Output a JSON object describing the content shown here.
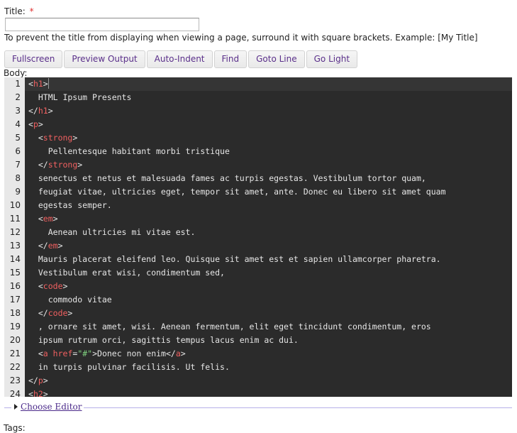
{
  "title_field": {
    "label": "Title:",
    "required_marker": "*",
    "value": "",
    "placeholder": ""
  },
  "hint": "To prevent the title from displaying when viewing a page, surround it with square brackets. Example: [My Title]",
  "toolbar": {
    "buttons": [
      {
        "label": "Fullscreen"
      },
      {
        "label": "Preview Output"
      },
      {
        "label": "Auto-Indent"
      },
      {
        "label": "Find"
      },
      {
        "label": "Goto Line"
      },
      {
        "label": "Go Light"
      }
    ]
  },
  "body_label": "Body:",
  "editor": {
    "active_line": 1,
    "lines": [
      {
        "n": "1",
        "segs": [
          [
            "b",
            "<"
          ],
          [
            "t",
            "h1"
          ],
          [
            "b",
            ">"
          ]
        ]
      },
      {
        "n": "2",
        "segs": [
          [
            "x",
            "  HTML Ipsum Presents"
          ]
        ]
      },
      {
        "n": "3",
        "segs": [
          [
            "b",
            "</"
          ],
          [
            "t",
            "h1"
          ],
          [
            "b",
            ">"
          ]
        ]
      },
      {
        "n": "4",
        "segs": [
          [
            "b",
            "<"
          ],
          [
            "t",
            "p"
          ],
          [
            "b",
            ">"
          ]
        ]
      },
      {
        "n": "5",
        "segs": [
          [
            "x",
            "  "
          ],
          [
            "b",
            "<"
          ],
          [
            "t",
            "strong"
          ],
          [
            "b",
            ">"
          ]
        ]
      },
      {
        "n": "6",
        "segs": [
          [
            "x",
            "    Pellentesque habitant morbi tristique"
          ]
        ]
      },
      {
        "n": "7",
        "segs": [
          [
            "x",
            "  "
          ],
          [
            "b",
            "</"
          ],
          [
            "t",
            "strong"
          ],
          [
            "b",
            ">"
          ]
        ]
      },
      {
        "n": "8",
        "segs": [
          [
            "x",
            "  senectus et netus et malesuada fames ac turpis egestas. Vestibulum tortor quam,"
          ]
        ]
      },
      {
        "n": "9",
        "segs": [
          [
            "x",
            "  feugiat vitae, ultricies eget, tempor sit amet, ante. Donec eu libero sit amet quam"
          ]
        ]
      },
      {
        "n": "10",
        "segs": [
          [
            "x",
            "  egestas semper."
          ]
        ]
      },
      {
        "n": "11",
        "segs": [
          [
            "x",
            "  "
          ],
          [
            "b",
            "<"
          ],
          [
            "t",
            "em"
          ],
          [
            "b",
            ">"
          ]
        ]
      },
      {
        "n": "12",
        "segs": [
          [
            "x",
            "    Aenean ultricies mi vitae est."
          ]
        ]
      },
      {
        "n": "13",
        "segs": [
          [
            "x",
            "  "
          ],
          [
            "b",
            "</"
          ],
          [
            "t",
            "em"
          ],
          [
            "b",
            ">"
          ]
        ]
      },
      {
        "n": "14",
        "segs": [
          [
            "x",
            "  Mauris placerat eleifend leo. Quisque sit amet est et sapien ullamcorper pharetra."
          ]
        ]
      },
      {
        "n": "15",
        "segs": [
          [
            "x",
            "  Vestibulum erat wisi, condimentum sed,"
          ]
        ]
      },
      {
        "n": "16",
        "segs": [
          [
            "x",
            "  "
          ],
          [
            "b",
            "<"
          ],
          [
            "t",
            "code"
          ],
          [
            "b",
            ">"
          ]
        ]
      },
      {
        "n": "17",
        "segs": [
          [
            "x",
            "    commodo vitae"
          ]
        ]
      },
      {
        "n": "18",
        "segs": [
          [
            "x",
            "  "
          ],
          [
            "b",
            "</"
          ],
          [
            "t",
            "code"
          ],
          [
            "b",
            ">"
          ]
        ]
      },
      {
        "n": "19",
        "segs": [
          [
            "x",
            "  , ornare sit amet, wisi. Aenean fermentum, elit eget tincidunt condimentum, eros"
          ]
        ]
      },
      {
        "n": "20",
        "segs": [
          [
            "x",
            "  ipsum rutrum orci, sagittis tempus lacus enim ac dui."
          ]
        ]
      },
      {
        "n": "21",
        "segs": [
          [
            "x",
            "  "
          ],
          [
            "b",
            "<"
          ],
          [
            "t",
            "a"
          ],
          [
            "x",
            " "
          ],
          [
            "a",
            "href"
          ],
          [
            "b",
            "="
          ],
          [
            "s",
            "\"#\""
          ],
          [
            "b",
            ">"
          ],
          [
            "x",
            "Donec non enim"
          ],
          [
            "b",
            "</"
          ],
          [
            "t",
            "a"
          ],
          [
            "b",
            ">"
          ]
        ]
      },
      {
        "n": "22",
        "segs": [
          [
            "x",
            "  in turpis pulvinar facilisis. Ut felis."
          ]
        ]
      },
      {
        "n": "23",
        "segs": [
          [
            "b",
            "</"
          ],
          [
            "t",
            "p"
          ],
          [
            "b",
            ">"
          ]
        ]
      },
      {
        "n": "24",
        "segs": [
          [
            "b",
            "<"
          ],
          [
            "t",
            "h2"
          ],
          [
            "b",
            ">"
          ]
        ]
      }
    ]
  },
  "choose_editor": {
    "label": "Choose Editor",
    "icon": "triangle-right-icon"
  },
  "tags_label": "Tags:",
  "colors": {
    "editor_bg": "#2b2b2b",
    "tag": "#f06060",
    "string": "#7fd07f",
    "button_text": "#5a2f8a",
    "required": "#e03030",
    "fieldset_line": "#b7b0e8"
  }
}
